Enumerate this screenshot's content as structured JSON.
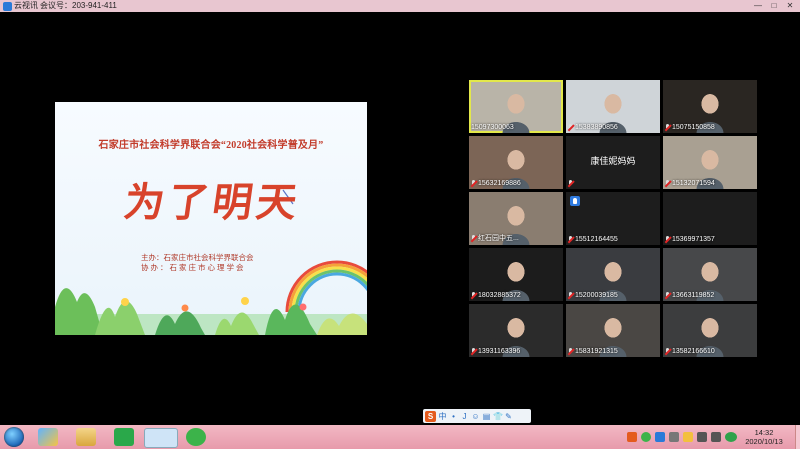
{
  "titlebar": {
    "app_name": "云视讯",
    "meeting_label": "会议号：203-941-411"
  },
  "slide": {
    "subtitle": "石家庄市社会科学界联合会“2020社会科学普及月”",
    "headline": "为了明天",
    "host_line": "主办：石家庄市社会科学界联合会",
    "coop_line": "协办：石家庄市心理学会"
  },
  "participants": [
    {
      "id": "15097300063",
      "active": true,
      "mic_muted": false,
      "bg": "#b9b4a8"
    },
    {
      "id": "15383890856",
      "active": false,
      "mic_muted": true,
      "bg": "#cfd4d8"
    },
    {
      "id": "15075150858",
      "active": false,
      "mic_muted": true,
      "bg": "#2a2622"
    },
    {
      "id": "15632169886",
      "active": false,
      "mic_muted": true,
      "bg": "#7c6556"
    },
    {
      "id": "",
      "display_name": "康佳妮妈妈",
      "active": false,
      "mic_muted": true,
      "bg": "#1d1d1d"
    },
    {
      "id": "15132071594",
      "active": false,
      "mic_muted": true,
      "bg": "#a9a092"
    },
    {
      "id": "红石园中五...",
      "active": false,
      "mic_muted": true,
      "bg": "#8a7d70"
    },
    {
      "id": "15512164455",
      "active": false,
      "mic_muted": true,
      "bg": "#1d1d1d",
      "hand": true
    },
    {
      "id": "15369971357",
      "active": false,
      "mic_muted": true,
      "bg": "#1d1d1d"
    },
    {
      "id": "18032885372",
      "active": false,
      "mic_muted": true,
      "bg": "#1c1c1c"
    },
    {
      "id": "15200039185",
      "active": false,
      "mic_muted": true,
      "bg": "#3a3c40"
    },
    {
      "id": "13663119852",
      "active": false,
      "mic_muted": true,
      "bg": "#47484a"
    },
    {
      "id": "13931163396",
      "active": false,
      "mic_muted": true,
      "bg": "#2b2b2b"
    },
    {
      "id": "15831921315",
      "active": false,
      "mic_muted": true,
      "bg": "#4a4744"
    },
    {
      "id": "13582166610",
      "active": false,
      "mic_muted": true,
      "bg": "#3c3d3e"
    }
  ],
  "toolbar": {
    "ime_logo": "S",
    "lang": "中",
    "items": [
      "•",
      "J",
      "☺",
      "▤",
      "👕",
      "✎"
    ]
  },
  "taskbar": {
    "time": "14:32",
    "date": "2020/10/13"
  }
}
